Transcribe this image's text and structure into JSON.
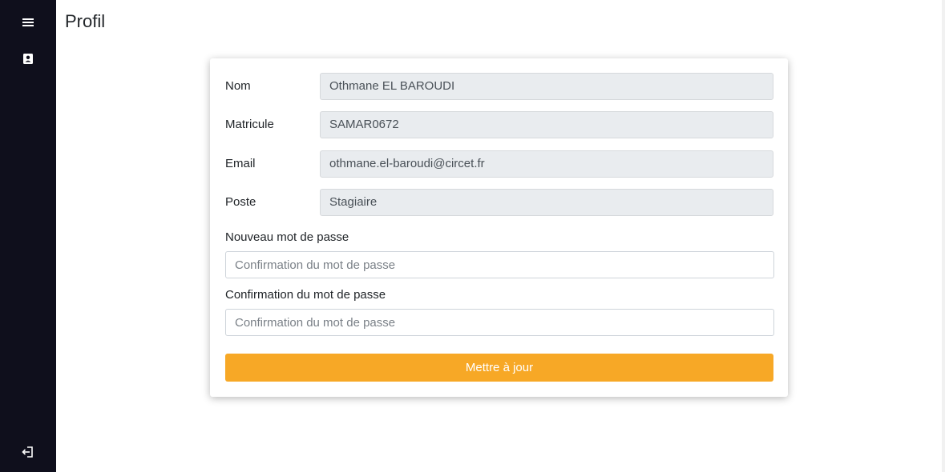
{
  "page": {
    "title": "Profil"
  },
  "sidebar": {
    "icons": [
      "menu-icon",
      "profile-card-icon",
      "logout-icon"
    ],
    "background": "#0f0f1c"
  },
  "profile": {
    "fields": [
      {
        "label": "Nom",
        "value": "Othmane EL BAROUDI"
      },
      {
        "label": "Matricule",
        "value": "SAMAR0672"
      },
      {
        "label": "Email",
        "value": "othmane.el-baroudi@circet.fr"
      },
      {
        "label": "Poste",
        "value": "Stagiaire"
      }
    ],
    "new_password": {
      "label": "Nouveau mot de passe",
      "placeholder": "Confirmation du mot de passe"
    },
    "confirm_password": {
      "label": "Confirmation du mot de passe",
      "placeholder": "Confirmation du mot de passe"
    },
    "submit_label": "Mettre à jour"
  },
  "colors": {
    "accent": "#f7a826",
    "readonly_bg": "#e9ecef"
  }
}
